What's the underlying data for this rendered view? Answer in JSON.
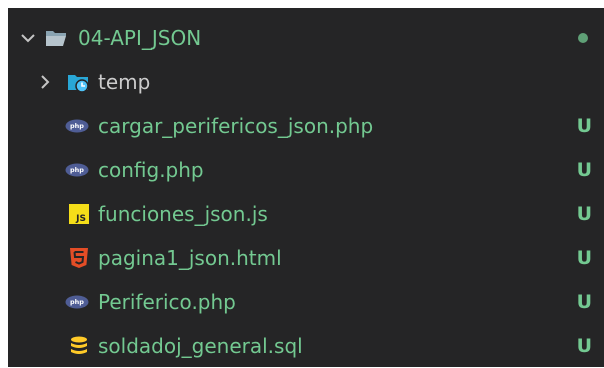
{
  "explorer": {
    "root": {
      "name": "04-API_JSON",
      "expanded": true,
      "icon": "folder-open-icon"
    },
    "items": [
      {
        "name": "temp",
        "type": "folder",
        "icon": "folder-temp-icon"
      },
      {
        "name": "cargar_perifericos_json.php",
        "type": "php",
        "status": "U",
        "icon": "php-icon"
      },
      {
        "name": "config.php",
        "type": "php",
        "status": "U",
        "icon": "php-icon"
      },
      {
        "name": "funciones_json.js",
        "type": "js",
        "status": "U",
        "icon": "js-icon"
      },
      {
        "name": "pagina1_json.html",
        "type": "html",
        "status": "U",
        "icon": "html5-icon"
      },
      {
        "name": "Periferico.php",
        "type": "php",
        "status": "U",
        "icon": "php-icon"
      },
      {
        "name": "soldadoj_general.sql",
        "type": "sql",
        "status": "U",
        "icon": "database-icon"
      }
    ]
  },
  "colors": {
    "background": "#252526",
    "untracked": "#73c991",
    "folder_text": "#cccccc",
    "php_icon": "#4f5d95",
    "js_icon": "#f5de19",
    "html_icon": "#e44d26",
    "sql_icon": "#ffca28"
  }
}
